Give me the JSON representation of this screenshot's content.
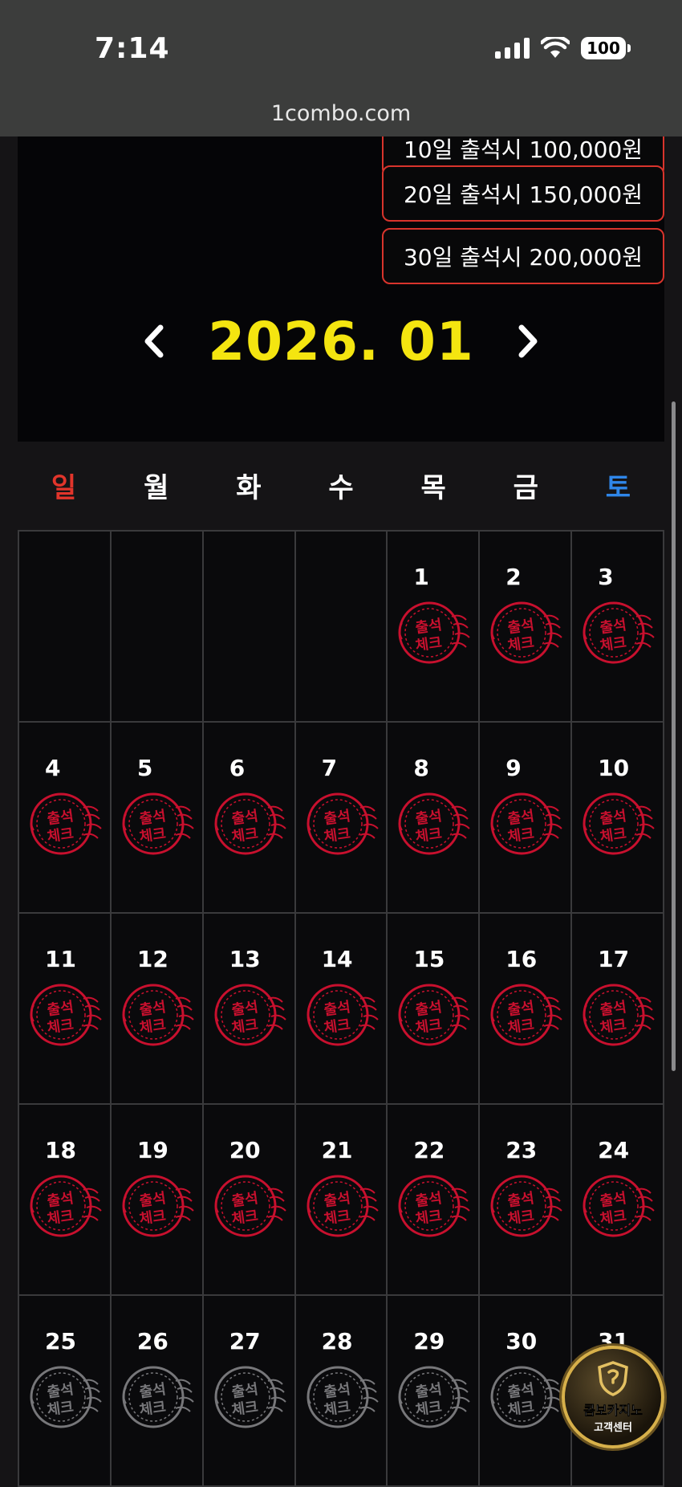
{
  "status_bar": {
    "time": "7:14",
    "battery": "100"
  },
  "browser": {
    "url": "1combo.com"
  },
  "rewards": [
    "10일 출석시 100,000원",
    "20일 출석시 150,000원",
    "30일 출석시 200,000원"
  ],
  "calendar": {
    "month_title": "2026. 01",
    "weekdays": [
      "일",
      "월",
      "화",
      "수",
      "목",
      "금",
      "토"
    ],
    "stamp_text": {
      "line1": "출석",
      "line2": "체크"
    },
    "colors": {
      "checked": "#c8102e",
      "unchecked": "#77777a",
      "sunday": "#e2352b",
      "saturday": "#2f86e8",
      "month": "#f4e510"
    },
    "weeks": [
      [
        null,
        null,
        null,
        null,
        {
          "day": "1",
          "checked": true
        },
        {
          "day": "2",
          "checked": true
        },
        {
          "day": "3",
          "checked": true
        }
      ],
      [
        {
          "day": "4",
          "checked": true
        },
        {
          "day": "5",
          "checked": true
        },
        {
          "day": "6",
          "checked": true
        },
        {
          "day": "7",
          "checked": true
        },
        {
          "day": "8",
          "checked": true
        },
        {
          "day": "9",
          "checked": true
        },
        {
          "day": "10",
          "checked": true
        }
      ],
      [
        {
          "day": "11",
          "checked": true
        },
        {
          "day": "12",
          "checked": true
        },
        {
          "day": "13",
          "checked": true
        },
        {
          "day": "14",
          "checked": true
        },
        {
          "day": "15",
          "checked": true
        },
        {
          "day": "16",
          "checked": true
        },
        {
          "day": "17",
          "checked": true
        }
      ],
      [
        {
          "day": "18",
          "checked": true
        },
        {
          "day": "19",
          "checked": true
        },
        {
          "day": "20",
          "checked": true
        },
        {
          "day": "21",
          "checked": true
        },
        {
          "day": "22",
          "checked": true
        },
        {
          "day": "23",
          "checked": true
        },
        {
          "day": "24",
          "checked": true
        }
      ],
      [
        {
          "day": "25",
          "checked": false
        },
        {
          "day": "26",
          "checked": false
        },
        {
          "day": "27",
          "checked": false
        },
        {
          "day": "28",
          "checked": false
        },
        {
          "day": "29",
          "checked": false
        },
        {
          "day": "30",
          "checked": false
        },
        {
          "day": "31",
          "checked": false
        }
      ]
    ]
  },
  "help_center": {
    "title": "콤보카지노",
    "subtitle": "고객센터",
    "icon": "shield-icon"
  }
}
